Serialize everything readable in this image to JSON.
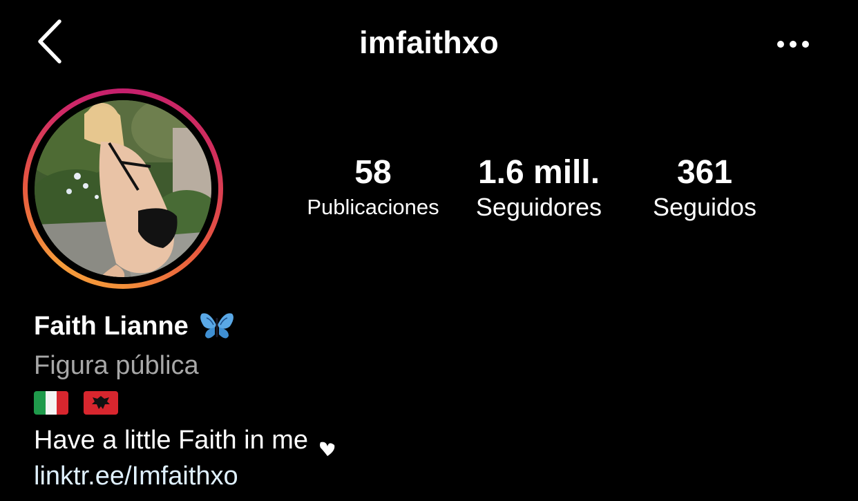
{
  "header": {
    "username": "imfaithxo",
    "back_icon": "chevron-left-icon",
    "more_icon": "more-horizontal-icon"
  },
  "profile": {
    "avatar_description_icon": "avatar",
    "story_ring_colors": [
      "#c41f6d",
      "#e95a3e",
      "#f59c3b"
    ]
  },
  "stats": {
    "posts": {
      "value": "58",
      "label": "Publicaciones"
    },
    "followers": {
      "value": "1.6 mill.",
      "label": "Seguidores"
    },
    "following": {
      "value": "361",
      "label": "Seguidos"
    }
  },
  "bio": {
    "full_name": "Faith Lianne",
    "name_emoji": "butterfly-icon",
    "category": "Figura pública",
    "flags": [
      "italy-flag-icon",
      "albania-flag-icon"
    ],
    "text": "Have a little Faith in me",
    "text_emoji": "heart-icon",
    "link": "linktr.ee/Imfaithxo"
  },
  "colors": {
    "background": "#000000",
    "text": "#ffffff",
    "secondary_text": "#a8a8a8",
    "link": "#e0f1ff"
  }
}
